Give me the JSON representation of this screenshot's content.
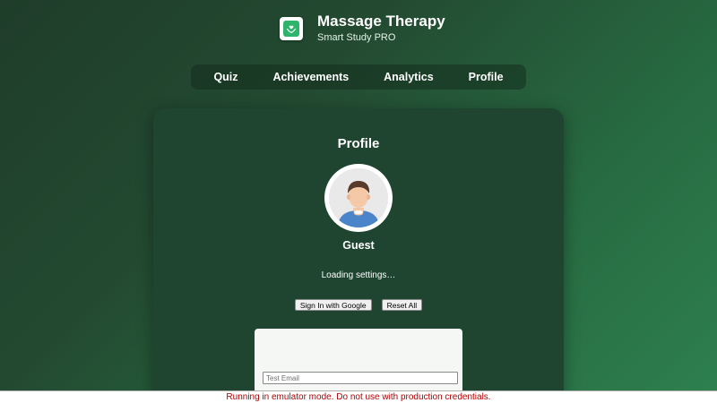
{
  "app": {
    "title": "Massage Therapy",
    "subtitle": "Smart Study PRO",
    "logo_icon": "heart-hands-icon",
    "accent_color": "#2fb56b"
  },
  "nav": {
    "items": [
      {
        "label": "Quiz"
      },
      {
        "label": "Achievements"
      },
      {
        "label": "Analytics"
      },
      {
        "label": "Profile"
      }
    ]
  },
  "profile": {
    "heading": "Profile",
    "avatar_icon": "user-avatar-icon",
    "username": "Guest",
    "status": "Loading settings…",
    "sign_in_label": "Sign In with Google",
    "reset_label": "Reset All"
  },
  "auth": {
    "heading": "",
    "email_placeholder": "Test Email",
    "email_value": ""
  },
  "emulator_banner": {
    "text": "Running in emulator mode. Do not use with production credentials.",
    "color": "#b00000"
  }
}
